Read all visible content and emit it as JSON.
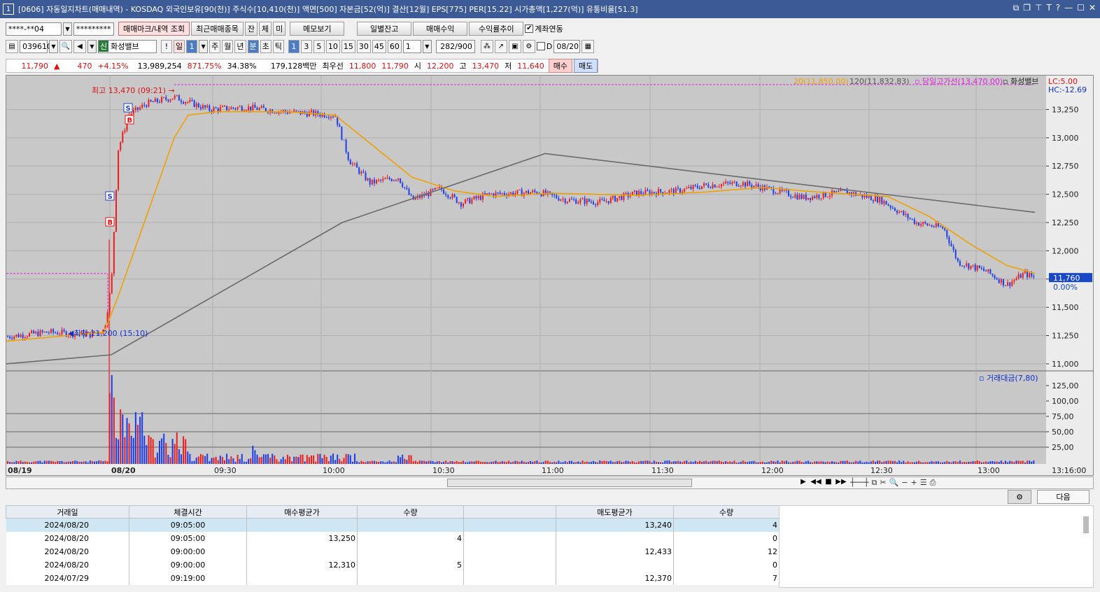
{
  "title": "[0606] 자동일지차트(매매내역) - KOSDAQ 외국인보유[90(천)] 주식수[10,410(천)] 액면[500] 자본금[52(억)] 결산[12월] EPS[775] PER[15.22] 시가총액[1,227(억)] 유통비율[51.3]",
  "window_icon": "1",
  "toolbar1": {
    "account": "****-**04",
    "password": "*********",
    "btn_trade_mark": "매매마크/내역 조회",
    "btn_recent": "최근매매종목",
    "btn_jan": "잔",
    "btn_che": "체",
    "btn_mi": "미",
    "btn_memo": "메모보기",
    "btn_daily": "일별잔고",
    "btn_profit": "매매수익",
    "btn_rate": "수익률추이",
    "chk_link": "계좌연동"
  },
  "toolbar2": {
    "code": "039610",
    "name_prefix": "신",
    "stock_name": "화성밸브",
    "excl": "!",
    "period_il": "일",
    "period_sel": "1",
    "periods": [
      "주",
      "월",
      "년"
    ],
    "min_label": "분",
    "sec_label": "초",
    "tick_label": "틱",
    "intervals": [
      "1",
      "3",
      "5",
      "10",
      "15",
      "30",
      "45",
      "60"
    ],
    "count": "1",
    "ratio": "282/900",
    "d_label": "D",
    "date": "08/20"
  },
  "quote": {
    "price": "11,790",
    "arrow": "▲",
    "change": "470",
    "pct": "+4.15%",
    "volume": "13,989,254",
    "vol_pct": "871.75%",
    "turnover": "34.38%",
    "amount": "179,128백만",
    "best_label": "최우선",
    "ask": "11,800",
    "bid": "11,790",
    "open_label": "시",
    "open": "12,200",
    "high_label": "고",
    "high": "13,470",
    "low_label": "저",
    "low": "11,640",
    "buy": "매수",
    "sell": "매도"
  },
  "chart_data": {
    "type": "candlestick",
    "legend": {
      "ma20": "20(11,850.00)",
      "ma120": "120(11,832.83)",
      "day_high_line": "당일고가선(13,470.00)",
      "name": "화성밸브"
    },
    "lc_label": "LC:5.00",
    "hc_label": "HC:-12.69",
    "y_ticks": [
      "13,250",
      "13,000",
      "12,750",
      "12,500",
      "12,250",
      "12,000",
      "11,750",
      "11,500",
      "11,250",
      "11,000"
    ],
    "y_range": [
      10950,
      13550
    ],
    "vol_ticks": [
      "125,00",
      "100,00",
      "75,00",
      "50,00",
      "25,00"
    ],
    "vol_legend": "거래대금(7,80)",
    "x_labels": [
      "08/19",
      "08/20",
      "09:30",
      "10:00",
      "10:30",
      "11:00",
      "11:30",
      "12:00",
      "12:30",
      "13:00",
      "13:16:00"
    ],
    "current_price": "11,760",
    "current_pct": "0.00%",
    "high_annot": "최고 13,470 (09:21)",
    "low_annot": "최저 11,200 (15:10)",
    "markers": [
      "S",
      "B",
      "S",
      "B"
    ],
    "prev_day_close": 11800,
    "ma120_points": [
      [
        0,
        11000
      ],
      [
        150,
        11080
      ],
      [
        480,
        12250
      ],
      [
        770,
        12860
      ],
      [
        1470,
        12340
      ]
    ]
  },
  "table": {
    "headers": [
      "거래일",
      "체결시간",
      "매수평균가",
      "수량",
      "",
      "매도평균가",
      "수량"
    ],
    "rows": [
      [
        "2024/08/20",
        "09:05:00",
        "",
        "",
        "",
        "13,240",
        "4"
      ],
      [
        "2024/08/20",
        "09:05:00",
        "13,250",
        "4",
        "",
        "",
        "0"
      ],
      [
        "2024/08/20",
        "09:00:00",
        "",
        "",
        "",
        "12,433",
        "12"
      ],
      [
        "2024/08/20",
        "09:00:00",
        "12,310",
        "5",
        "",
        "",
        "0"
      ],
      [
        "2024/07/29",
        "09:19:00",
        "",
        "",
        "",
        "12,370",
        "7"
      ]
    ]
  },
  "next_btn": "다음"
}
